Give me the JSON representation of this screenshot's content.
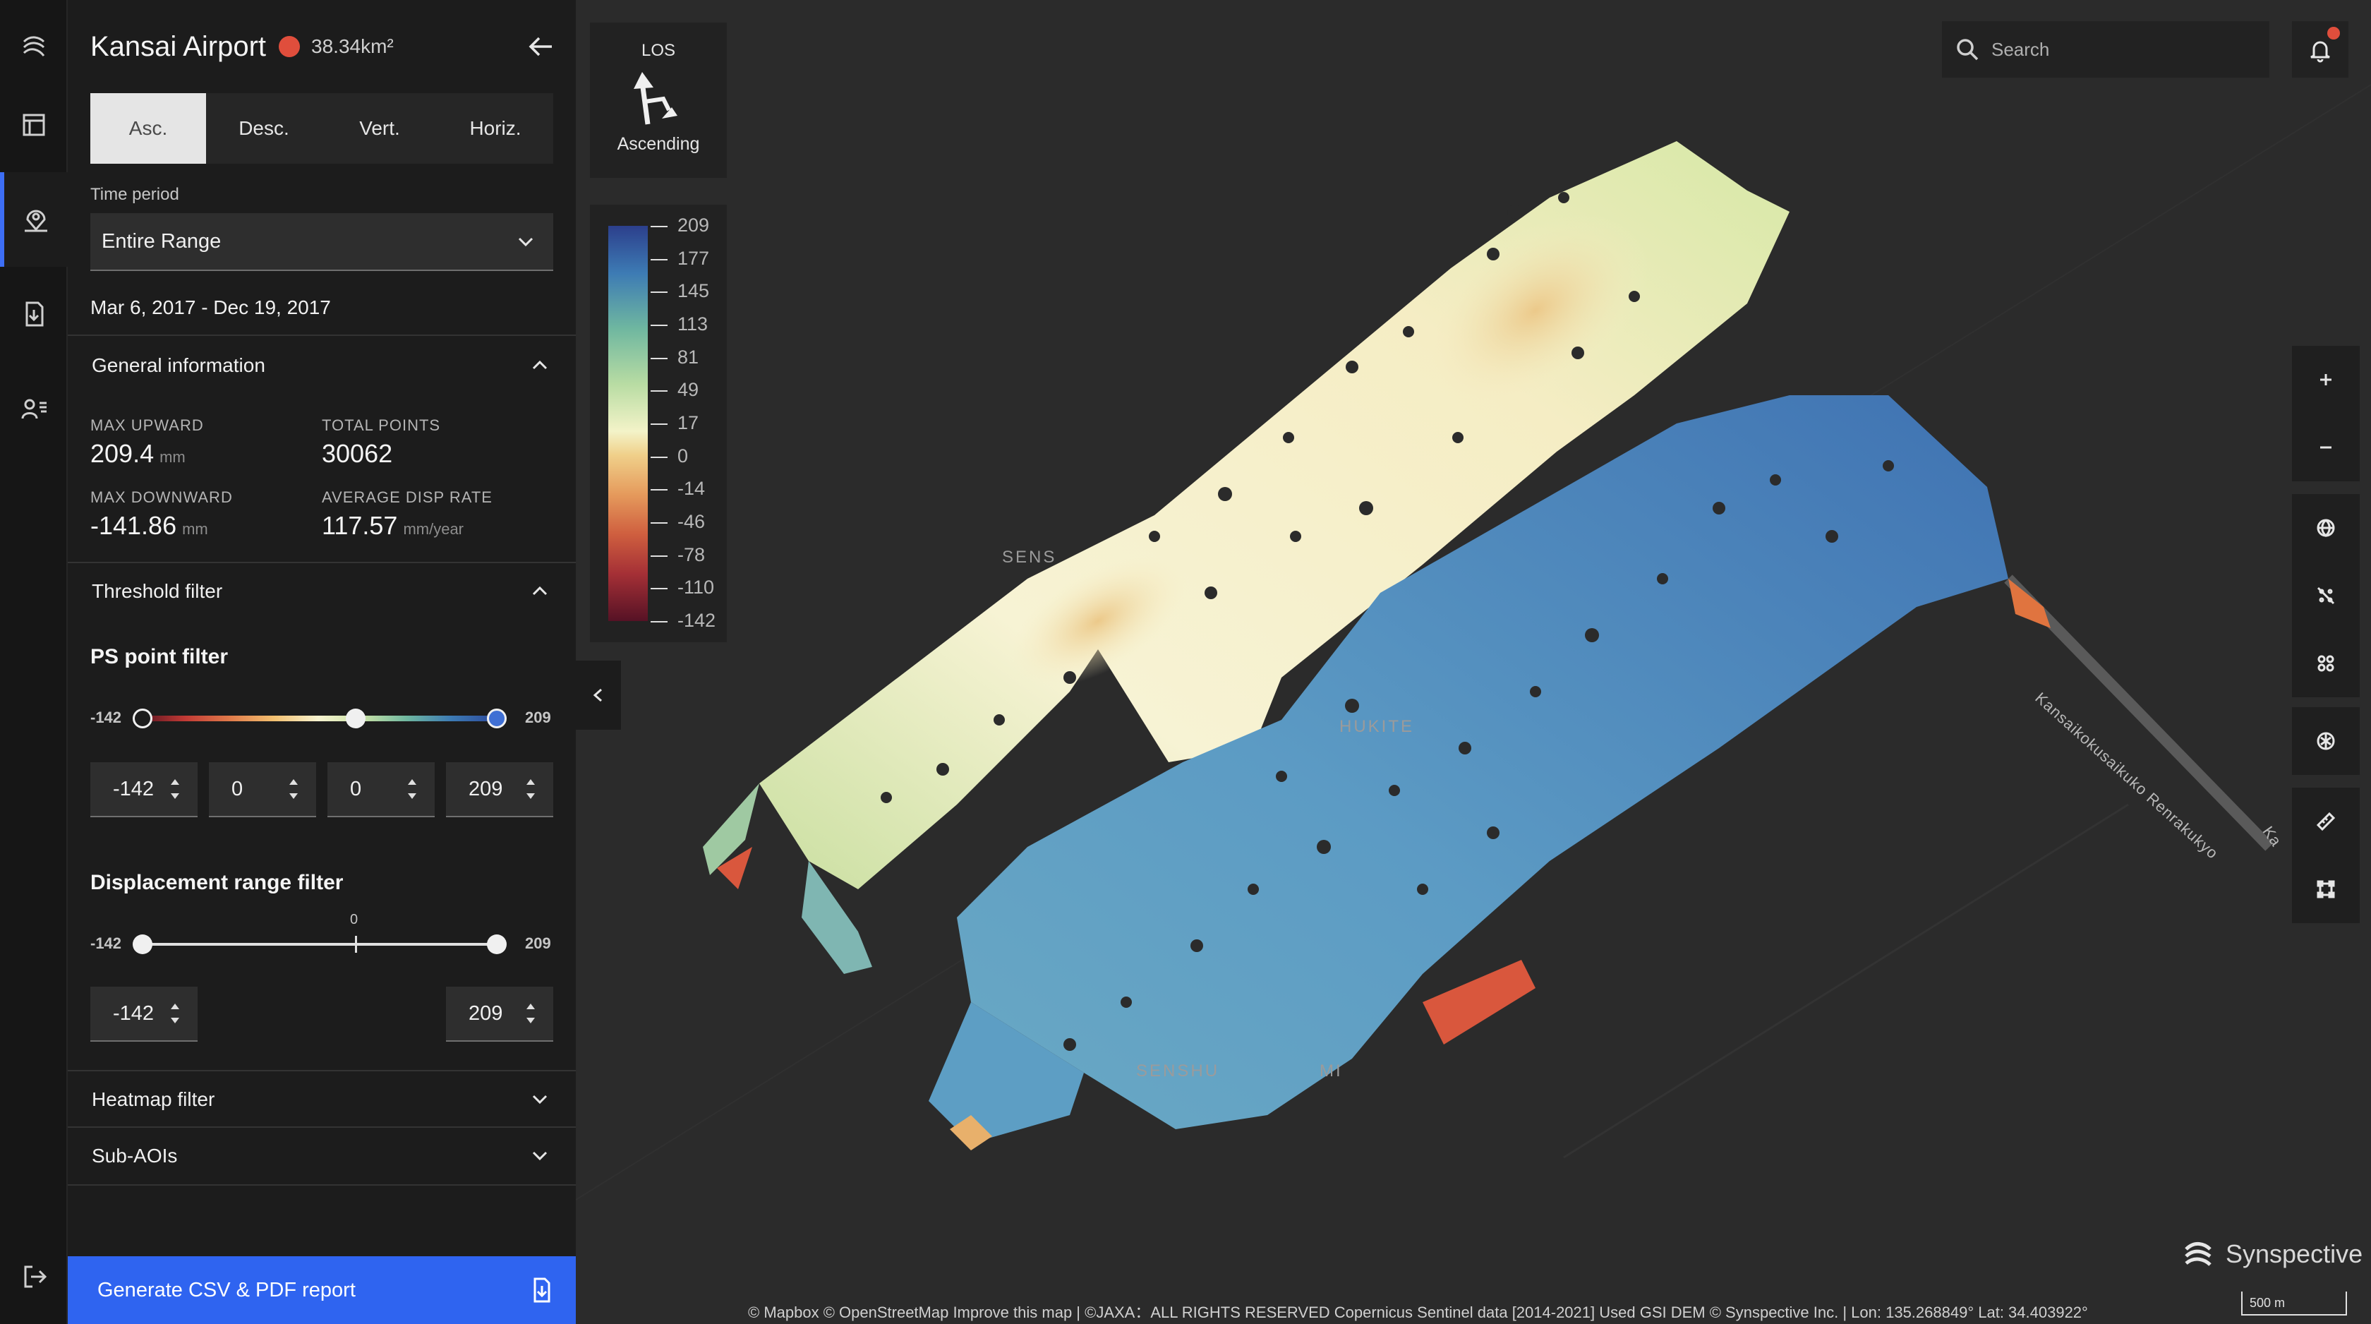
{
  "rail": {
    "items": [
      {
        "name": "logo",
        "icon": "synspective-logo-icon"
      },
      {
        "name": "dashboard",
        "icon": "dashboard-icon"
      },
      {
        "name": "aoi",
        "icon": "map-pin-icon"
      },
      {
        "name": "reports",
        "icon": "document-download-icon"
      },
      {
        "name": "users",
        "icon": "user-list-icon"
      },
      {
        "name": "logout",
        "icon": "logout-icon"
      }
    ]
  },
  "aoi": {
    "title": "Kansai Airport",
    "area": "38.34km²",
    "status_color": "#e04e3c"
  },
  "tabs": [
    {
      "label": "Asc.",
      "active": true
    },
    {
      "label": "Desc.",
      "active": false
    },
    {
      "label": "Vert.",
      "active": false
    },
    {
      "label": "Horiz.",
      "active": false
    }
  ],
  "time_period": {
    "label": "Time period",
    "value": "Entire Range",
    "date_range": "Mar 6, 2017 - Dec 19, 2017"
  },
  "general_info": {
    "title": "General information",
    "max_upward_label": "MAX UPWARD",
    "max_upward_value": "209.4",
    "max_upward_unit": "mm",
    "total_points_label": "TOTAL POINTS",
    "total_points_value": "30062",
    "max_downward_label": "MAX DOWNWARD",
    "max_downward_value": "-141.86",
    "max_downward_unit": "mm",
    "avg_rate_label": "AVERAGE DISP RATE",
    "avg_rate_value": "117.57",
    "avg_rate_unit": "mm/year"
  },
  "threshold_filter": {
    "title": "Threshold filter",
    "ps_title": "PS point filter",
    "min_label": "-142",
    "max_label": "209",
    "inputs": [
      "-142",
      "0",
      "0",
      "209"
    ]
  },
  "displacement_filter": {
    "title": "Displacement range filter",
    "min_label": "-142",
    "max_label": "209",
    "zero_label": "0",
    "inputs": [
      "-142",
      "209"
    ]
  },
  "heatmap_filter": {
    "title": "Heatmap filter"
  },
  "sub_aois": {
    "title": "Sub-AOIs"
  },
  "generate_button": {
    "label": "Generate CSV & PDF report"
  },
  "los": {
    "title": "LOS",
    "mode": "Ascending"
  },
  "legend": {
    "values": [
      "209",
      "177",
      "145",
      "113",
      "81",
      "49",
      "17",
      "0",
      "-14",
      "-46",
      "-78",
      "-110",
      "-142"
    ]
  },
  "search": {
    "placeholder": "Search"
  },
  "map": {
    "labels": [
      "SE",
      "SENS",
      "HUKITE",
      "SENSHU",
      "MI",
      "Kansaikokusaikuko Renrakukyo",
      "Ka"
    ],
    "attribution": "© Mapbox © OpenStreetMap Improve this map  | ©JAXA：ALL RIGHTS RESERVED Copernicus Sentinel data [2014-2021] Used GSI DEM © Synspective Inc. | Lon: 135.268849° Lat: 34.403922°",
    "scale": "500 m"
  },
  "brand": {
    "name": "Synspective"
  },
  "colors": {
    "accent": "#2f64f0",
    "panel": "#1c1c1c",
    "map_bg": "#2b2b2b"
  }
}
